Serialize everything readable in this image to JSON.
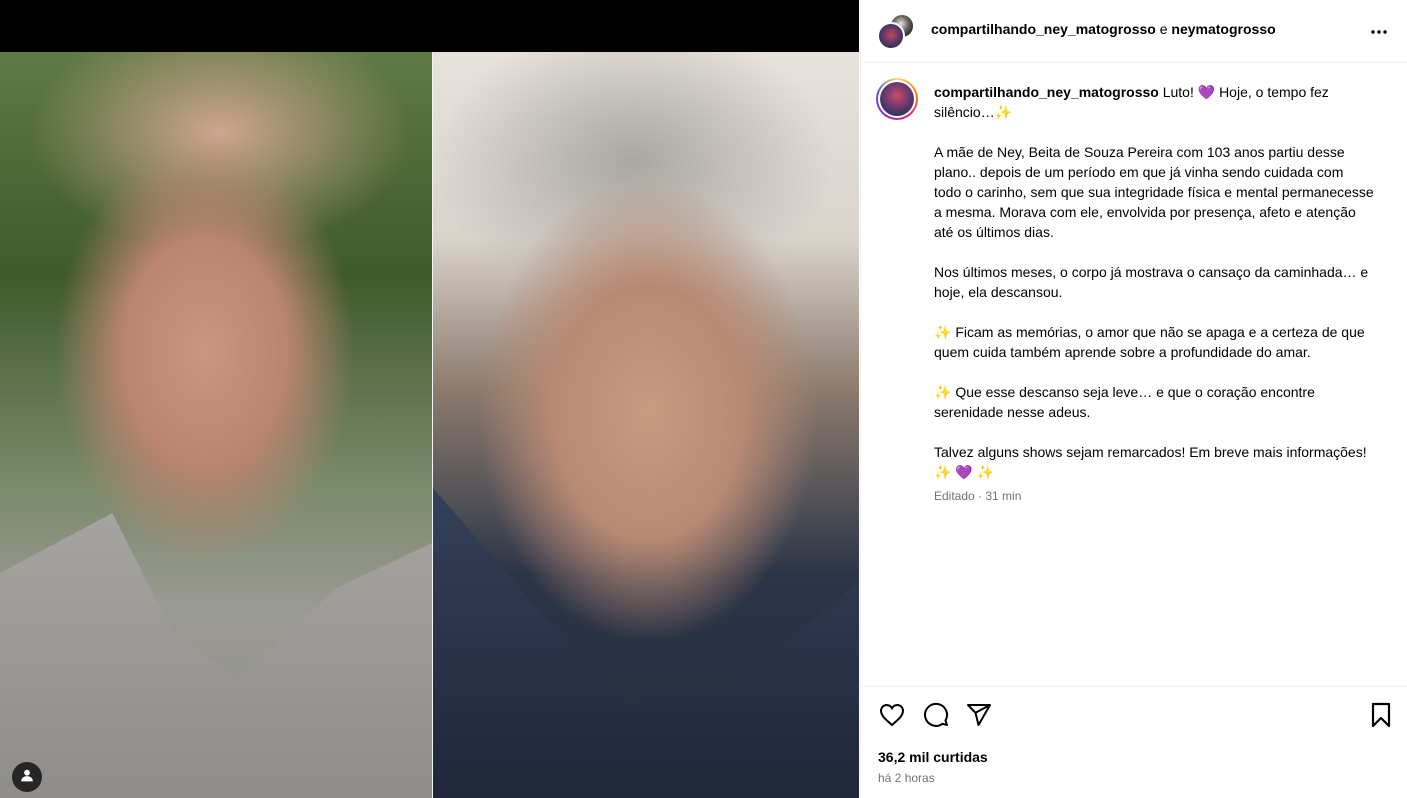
{
  "media": {
    "icons": {
      "tag": "user-tag-icon"
    }
  },
  "header": {
    "author": "compartilhando_ney_matogrosso",
    "conjunction": "e",
    "collaborator": "neymatogrosso",
    "more_icon": "more-options-icon"
  },
  "caption": {
    "username": "compartilhando_ney_matogrosso",
    "line1": "Luto! 💜 Hoje, o tempo fez silêncio…✨",
    "para2": "A mãe de Ney, Beita de Souza Pereira com 103 anos partiu desse plano.. depois de um período em que já vinha sendo cuidada com todo o carinho, sem que sua integridade física e mental permanecesse a mesma. Morava com ele, envolvida por presença, afeto e atenção até os últimos dias.",
    "para3": "Nos últimos meses, o corpo já mostrava o cansaço da caminhada… e hoje, ela descansou.",
    "para4": "✨ Ficam as memórias, o amor que não se apaga e a certeza de que quem cuida também aprende sobre a profundidade do amar.",
    "para5": "✨ Que esse descanso seja leve… e que o coração encontre serenidade nesse adeus.",
    "para6": "Talvez alguns shows sejam remarcados! Em breve mais informações! ✨ 💜 ✨",
    "meta": "Editado · 31 min"
  },
  "actions": {
    "icons": [
      "heart-icon",
      "comment-icon",
      "share-icon",
      "bookmark-icon"
    ],
    "likes": "36,2 mil curtidas",
    "posted": "há 2 horas"
  },
  "colors": {
    "text": "#000000",
    "secondary_text": "#737373",
    "divider": "#efefef",
    "media_bg": "#000000"
  }
}
